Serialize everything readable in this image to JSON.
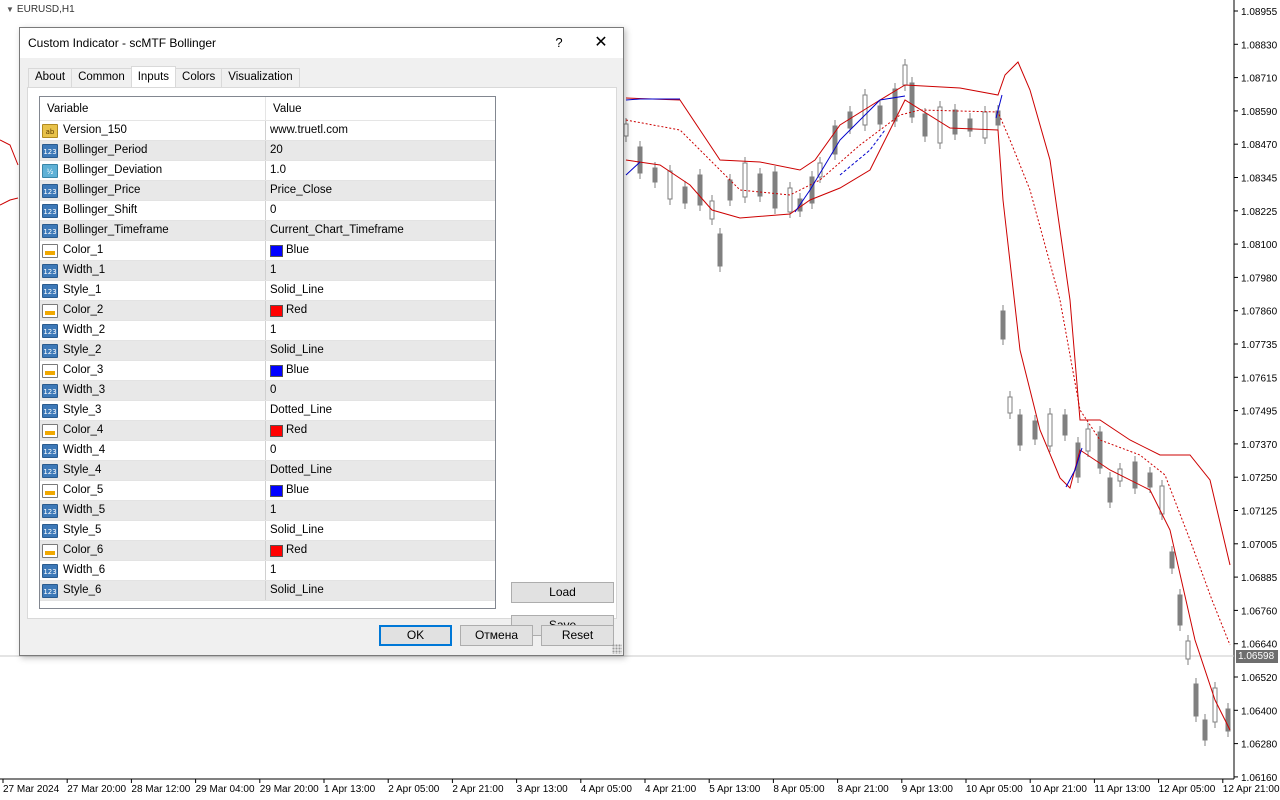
{
  "chart": {
    "symbol": "EURUSD,H1",
    "current_price": "1.06598",
    "price_labels": [
      "1.08955",
      "1.08830",
      "1.08710",
      "1.08590",
      "1.08470",
      "1.08345",
      "1.08225",
      "1.08100",
      "1.07980",
      "1.07860",
      "1.07735",
      "1.07615",
      "1.07495",
      "1.07370",
      "1.07250",
      "1.07125",
      "1.07005",
      "1.06885",
      "1.06760",
      "1.06640",
      "1.06520",
      "1.06400",
      "1.06280",
      "1.06160"
    ],
    "time_labels": [
      "27 Mar 2024",
      "27 Mar 20:00",
      "28 Mar 12:00",
      "29 Mar 04:00",
      "29 Mar 20:00",
      "1 Apr 13:00",
      "2 Apr 05:00",
      "2 Apr 21:00",
      "3 Apr 13:00",
      "4 Apr 05:00",
      "4 Apr 21:00",
      "5 Apr 13:00",
      "8 Apr 05:00",
      "8 Apr 21:00",
      "9 Apr 13:00",
      "10 Apr 05:00",
      "10 Apr 21:00",
      "11 Apr 13:00",
      "12 Apr 05:00",
      "12 Apr 21:00"
    ],
    "colors": {
      "upper_band": "#cc0000",
      "lower_band": "#cc0000",
      "mid_band": "#cc0000",
      "blue_band": "#0000cc",
      "candles": "#808080"
    }
  },
  "dialog": {
    "title": "Custom Indicator - scMTF Bollinger",
    "help": "?",
    "close": "✕",
    "tabs": [
      {
        "label": "About"
      },
      {
        "label": "Common"
      },
      {
        "label": "Inputs"
      },
      {
        "label": "Colors"
      },
      {
        "label": "Visualization"
      }
    ],
    "active_tab": "Inputs",
    "columns": {
      "variable": "Variable",
      "value": "Value"
    },
    "rows": [
      {
        "variable": "Version_150",
        "value": "www.truetl.com",
        "icon": "ab"
      },
      {
        "variable": "Bollinger_Period",
        "value": "20",
        "icon": "123"
      },
      {
        "variable": "Bollinger_Deviation",
        "value": "1.0",
        "icon": "½"
      },
      {
        "variable": "Bollinger_Price",
        "value": "Price_Close",
        "icon": "123"
      },
      {
        "variable": "Bollinger_Shift",
        "value": "0",
        "icon": "123"
      },
      {
        "variable": "Bollinger_Timeframe",
        "value": "Current_Chart_Timeframe",
        "icon": "123"
      },
      {
        "variable": "Color_1",
        "value": "Blue",
        "icon": "color",
        "swatch": "#0000ff"
      },
      {
        "variable": "Width_1",
        "value": "1",
        "icon": "123"
      },
      {
        "variable": "Style_1",
        "value": "Solid_Line",
        "icon": "123"
      },
      {
        "variable": "Color_2",
        "value": "Red",
        "icon": "color",
        "swatch": "#ff0000"
      },
      {
        "variable": "Width_2",
        "value": "1",
        "icon": "123"
      },
      {
        "variable": "Style_2",
        "value": "Solid_Line",
        "icon": "123"
      },
      {
        "variable": "Color_3",
        "value": "Blue",
        "icon": "color",
        "swatch": "#0000ff"
      },
      {
        "variable": "Width_3",
        "value": "0",
        "icon": "123"
      },
      {
        "variable": "Style_3",
        "value": "Dotted_Line",
        "icon": "123"
      },
      {
        "variable": "Color_4",
        "value": "Red",
        "icon": "color",
        "swatch": "#ff0000"
      },
      {
        "variable": "Width_4",
        "value": "0",
        "icon": "123"
      },
      {
        "variable": "Style_4",
        "value": "Dotted_Line",
        "icon": "123"
      },
      {
        "variable": "Color_5",
        "value": "Blue",
        "icon": "color",
        "swatch": "#0000ff"
      },
      {
        "variable": "Width_5",
        "value": "1",
        "icon": "123"
      },
      {
        "variable": "Style_5",
        "value": "Solid_Line",
        "icon": "123"
      },
      {
        "variable": "Color_6",
        "value": "Red",
        "icon": "color",
        "swatch": "#ff0000"
      },
      {
        "variable": "Width_6",
        "value": "1",
        "icon": "123"
      },
      {
        "variable": "Style_6",
        "value": "Solid_Line",
        "icon": "123"
      }
    ],
    "buttons": {
      "load": "Load",
      "save": "Save",
      "ok": "OK",
      "cancel": "Отмена",
      "reset": "Reset"
    }
  }
}
